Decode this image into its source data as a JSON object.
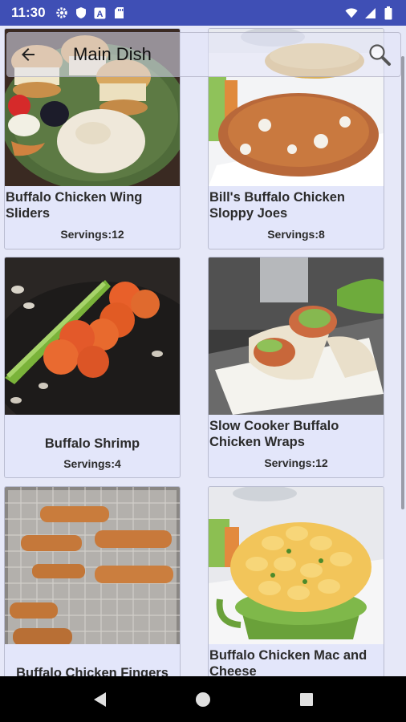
{
  "status_bar": {
    "time": "11:30",
    "icons_left": [
      "gear-icon",
      "shield-icon",
      "a-badge-icon",
      "sd-card-icon"
    ],
    "icons_right": [
      "wifi-icon",
      "signal-icon",
      "battery-icon"
    ]
  },
  "toolbar": {
    "title": "Main Dish",
    "back_icon": "arrow-back-icon",
    "search_icon": "search-icon"
  },
  "recipes": [
    {
      "title": "Buffalo Chicken Wing Sliders",
      "servings": "Servings:12"
    },
    {
      "title": "Bill's Buffalo Chicken Sloppy Joes",
      "servings": "Servings:8"
    },
    {
      "title": "Buffalo Shrimp",
      "servings": "Servings:4"
    },
    {
      "title": "Slow Cooker Buffalo Chicken Wraps",
      "servings": "Servings:12"
    },
    {
      "title": "Buffalo Chicken Fingers",
      "servings": ""
    },
    {
      "title": "Buffalo Chicken Mac and Cheese",
      "servings": ""
    }
  ],
  "nav_bar": {
    "buttons": [
      "back-triangle-icon",
      "home-circle-icon",
      "recents-square-icon"
    ]
  }
}
